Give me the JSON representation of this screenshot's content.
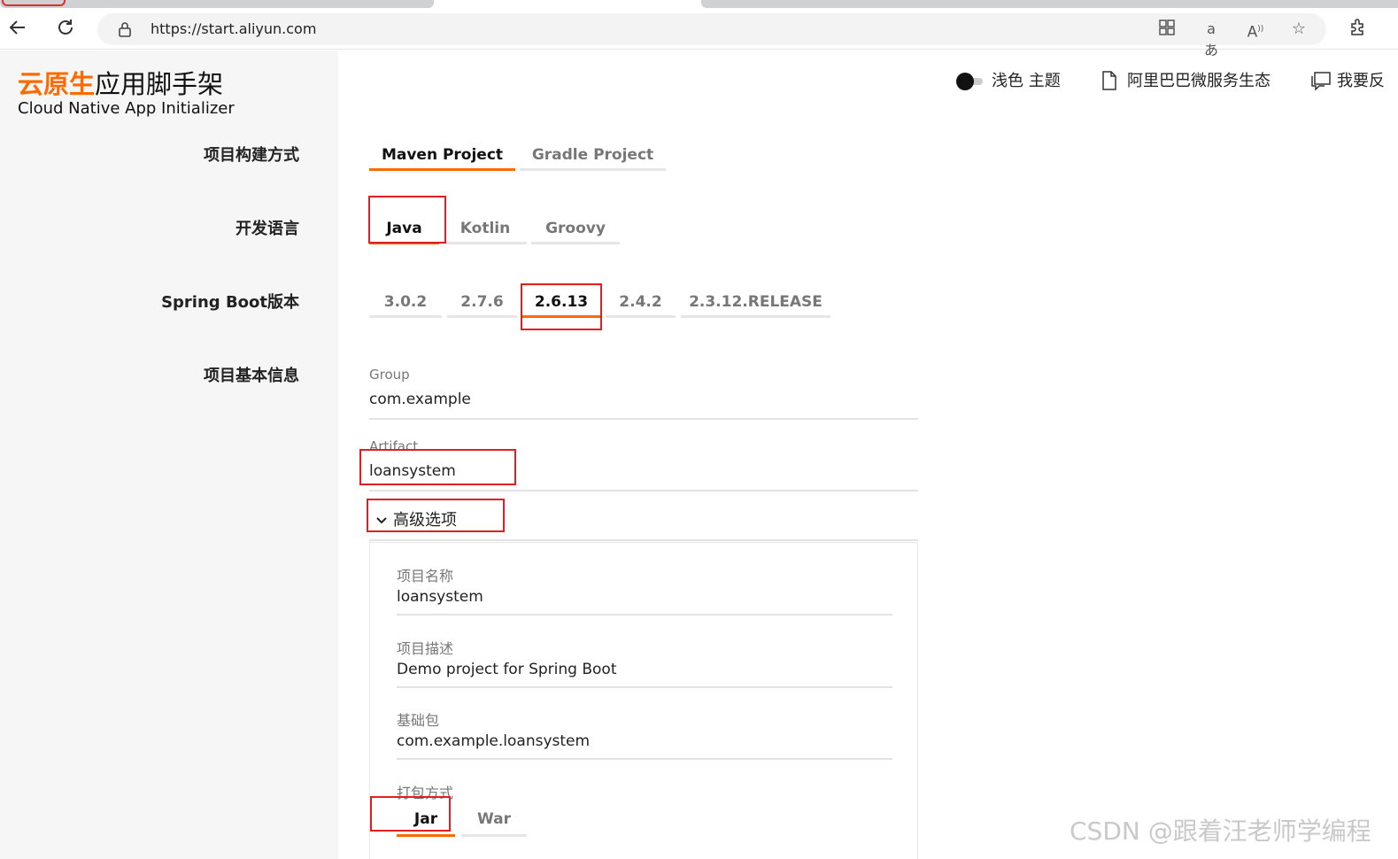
{
  "browser": {
    "url": "https://start.aliyun.com",
    "back_icon": "back-arrow-icon",
    "reload_icon": "reload-icon",
    "toolbar_icons": [
      "apps-icon",
      "translate-icon",
      "read-aloud-icon",
      "favorite-star-icon",
      "extensions-icon"
    ]
  },
  "brand": {
    "title_accent": "云原生",
    "title_rest": "应用脚手架",
    "subtitle": "Cloud Native App Initializer",
    "accent_color": "#ff6a00"
  },
  "topnav": {
    "theme_label": "浅色 主题",
    "ecosystem_label": "阿里巴巴微服务生态",
    "feedback_label": "我要反"
  },
  "build": {
    "label": "项目构建方式",
    "options": [
      "Maven Project",
      "Gradle Project"
    ],
    "selected": "Maven Project"
  },
  "language": {
    "label": "开发语言",
    "options": [
      "Java",
      "Kotlin",
      "Groovy"
    ],
    "selected": "Java"
  },
  "boot": {
    "label": "Spring Boot版本",
    "options": [
      "3.0.2",
      "2.7.6",
      "2.6.13",
      "2.4.2",
      "2.3.12.RELEASE"
    ],
    "selected": "2.6.13"
  },
  "info": {
    "label": "项目基本信息",
    "group_label": "Group",
    "group_value": "com.example",
    "artifact_label": "Artifact",
    "artifact_value": "loansystem"
  },
  "advanced": {
    "toggle_label": "高级选项",
    "name_label": "项目名称",
    "name_value": "loansystem",
    "desc_label": "项目描述",
    "desc_value": "Demo project for Spring Boot",
    "package_label": "基础包",
    "package_value": "com.example.loansystem",
    "packaging_label": "打包方式",
    "packaging_options": [
      "Jar",
      "War"
    ],
    "packaging_selected": "Jar"
  },
  "watermark": "CSDN @跟着汪老师学编程"
}
